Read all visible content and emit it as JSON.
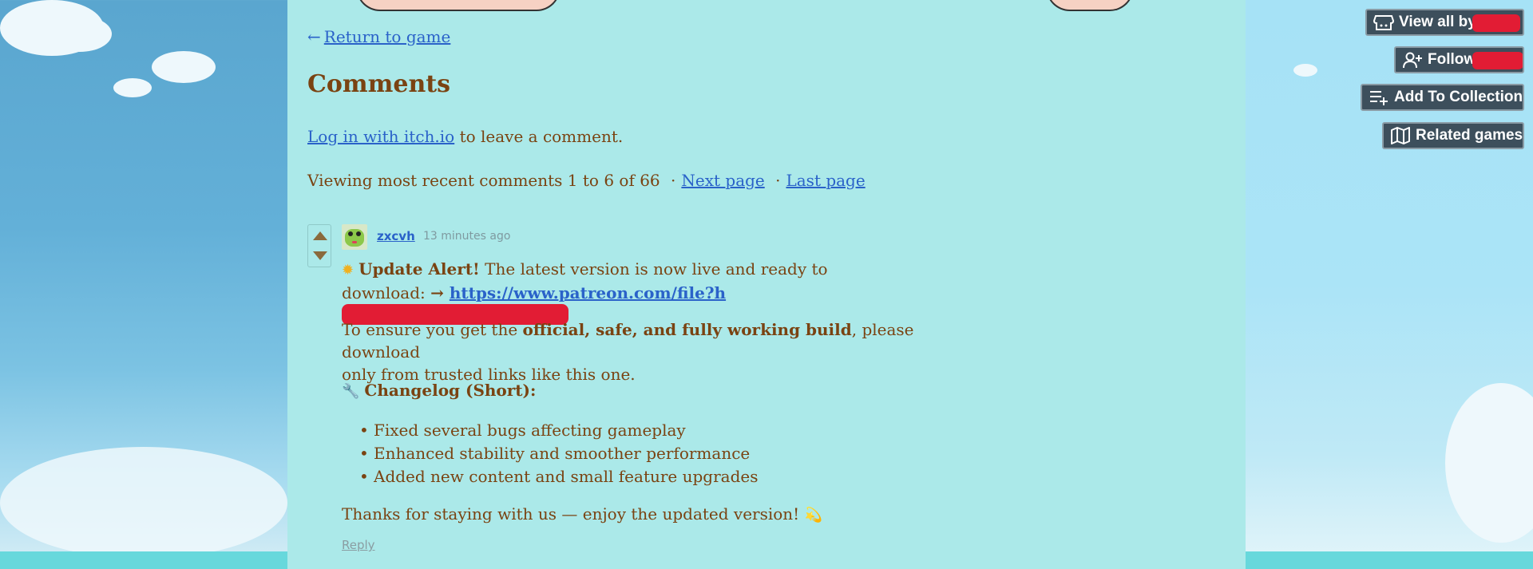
{
  "back_link": {
    "arrow": "←",
    "label": "Return to game"
  },
  "comments_title": "Comments",
  "login": {
    "link": "Log in with itch.io",
    "suffix": " to leave a comment."
  },
  "viewing": {
    "text": "Viewing most recent comments 1 to 6 of 66",
    "separator": "·",
    "next_page": "Next page",
    "last_page": "Last page"
  },
  "comment": {
    "username": "zxcvh",
    "time": "13 minutes ago",
    "sun_icon": "sun-icon",
    "alert_title": "Update Alert!",
    "alert_text_1": " The latest version is now live and ready to",
    "alert_text_2": "download: ",
    "arrow": "→ ",
    "link_text": "https://www.patreon.com/file?h",
    "para2_pre": "To ensure you get the ",
    "para2_bold": "official, safe, and fully working build",
    "para2_post": ", please download",
    "para2_line2": "only from trusted links like this one.",
    "wrench_icon": "wrench-icon",
    "changelog_title": "Changelog (Short):",
    "changelog": [
      "Fixed several bugs affecting gameplay",
      "Enhanced stability and smoother performance",
      "Added new content and small feature upgrades"
    ],
    "thanks": "Thanks for staying with us — enjoy the updated version! ",
    "dizzy_icon": "dizzy-icon",
    "reply": "Reply"
  },
  "side_buttons": {
    "view_all": "View all by",
    "follow": "Follow",
    "add_collection": "Add To Collection",
    "related": "Related games"
  },
  "colors": {
    "column_bg": "#abe9e9",
    "text_brown": "#7a4312",
    "link_blue": "#2a62c9",
    "redaction": "#e21c34",
    "button_bg": "#3d4f5c"
  }
}
